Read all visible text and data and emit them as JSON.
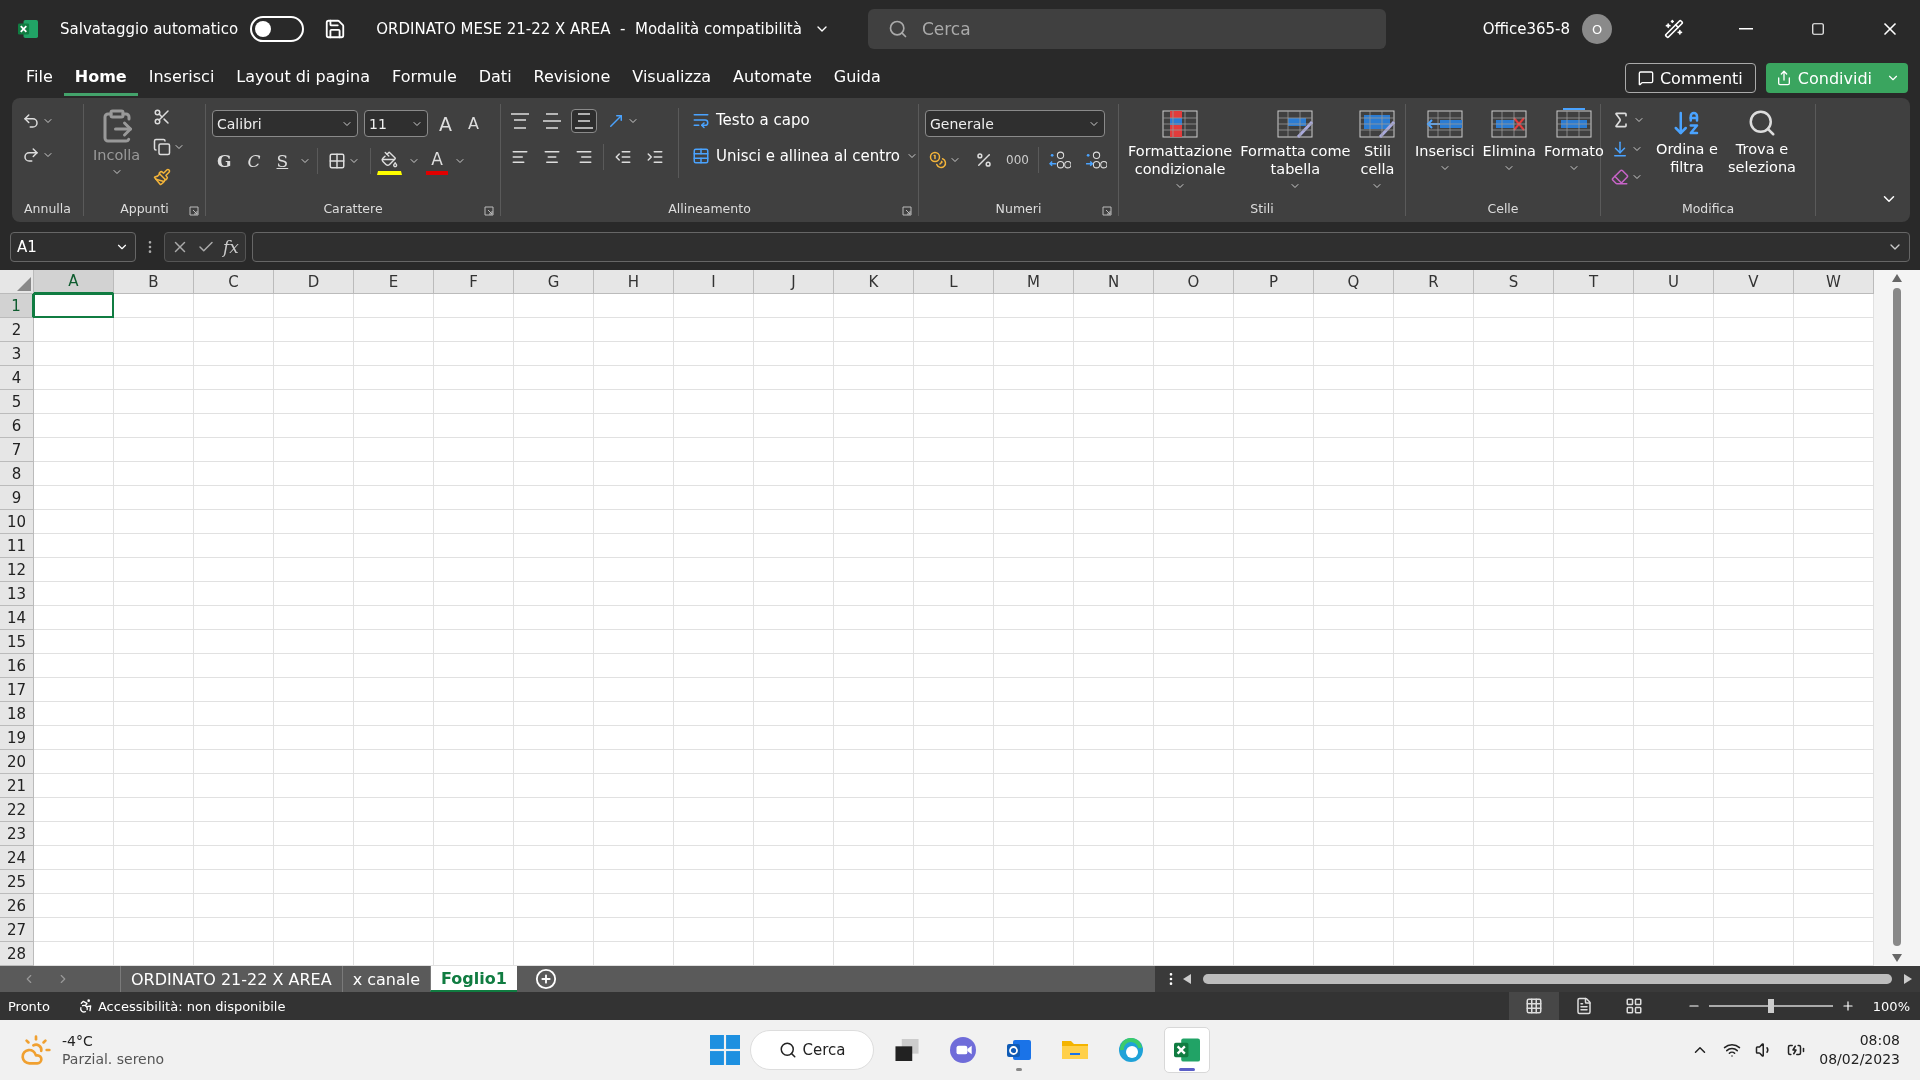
{
  "title_bar": {
    "autosave_label": "Salvataggio automatico",
    "autosave_on": false,
    "document_title": "ORDINATO MESE 21-22 X AREA  -  Modalità compatibilità",
    "search_placeholder": "Cerca",
    "account": "Office365-8",
    "avatar_initial": "O"
  },
  "menu_tabs": [
    {
      "label": "File",
      "selected": false
    },
    {
      "label": "Home",
      "selected": true
    },
    {
      "label": "Inserisci",
      "selected": false
    },
    {
      "label": "Layout di pagina",
      "selected": false
    },
    {
      "label": "Formule",
      "selected": false
    },
    {
      "label": "Dati",
      "selected": false
    },
    {
      "label": "Revisione",
      "selected": false
    },
    {
      "label": "Visualizza",
      "selected": false
    },
    {
      "label": "Automate",
      "selected": false
    },
    {
      "label": "Guida",
      "selected": false
    }
  ],
  "actions": {
    "comments": "Commenti",
    "share": "Condividi"
  },
  "ribbon": {
    "undo": {
      "label": "Annulla"
    },
    "clipboard": {
      "label": "Appunti",
      "paste": "Incolla"
    },
    "font": {
      "label": "Carattere",
      "font_name": "Calibri",
      "font_size": "11",
      "grow": "A",
      "shrink": "A",
      "bold": "G",
      "italic": "C",
      "underline": "S",
      "font_color": "A"
    },
    "alignment": {
      "label": "Allineamento",
      "vertical": [
        {
          "selected": false
        },
        {
          "selected": false
        },
        {
          "selected": true
        }
      ],
      "wrap": "Testo a capo",
      "merge": "Unisci e allinea al centro"
    },
    "number": {
      "label": "Numeri",
      "format": "Generale",
      "thousands": "000"
    },
    "styles": {
      "label": "Stili",
      "buttons": [
        {
          "kind": "conditional",
          "label": "Formattazione\ncondizionale"
        },
        {
          "kind": "table",
          "label": "Formatta come\ntabella"
        },
        {
          "kind": "cell",
          "label": "Stili\ncella"
        }
      ]
    },
    "cells": {
      "label": "Celle",
      "buttons": [
        {
          "kind": "insert",
          "label": "Inserisci"
        },
        {
          "kind": "delete",
          "label": "Elimina"
        },
        {
          "kind": "format",
          "label": "Formato"
        }
      ]
    },
    "editing": {
      "label": "Modifica",
      "buttons": [
        {
          "kind": "sort",
          "label": "Ordina e\nfiltra"
        },
        {
          "kind": "find",
          "label": "Trova e\nseleziona"
        }
      ]
    }
  },
  "formula_bar": {
    "name_box": "A1",
    "function_glyph": "fx"
  },
  "grid": {
    "columns": [
      {
        "label": "A",
        "selected": true
      },
      {
        "label": "B",
        "selected": false
      },
      {
        "label": "C",
        "selected": false
      },
      {
        "label": "D",
        "selected": false
      },
      {
        "label": "E",
        "selected": false
      },
      {
        "label": "F",
        "selected": false
      },
      {
        "label": "G",
        "selected": false
      },
      {
        "label": "H",
        "selected": false
      },
      {
        "label": "I",
        "selected": false
      },
      {
        "label": "J",
        "selected": false
      },
      {
        "label": "K",
        "selected": false
      },
      {
        "label": "L",
        "selected": false
      },
      {
        "label": "M",
        "selected": false
      },
      {
        "label": "N",
        "selected": false
      },
      {
        "label": "O",
        "selected": false
      },
      {
        "label": "P",
        "selected": false
      },
      {
        "label": "Q",
        "selected": false
      },
      {
        "label": "R",
        "selected": false
      },
      {
        "label": "S",
        "selected": false
      },
      {
        "label": "T",
        "selected": false
      },
      {
        "label": "U",
        "selected": false
      },
      {
        "label": "V",
        "selected": false
      },
      {
        "label": "W",
        "selected": false
      }
    ],
    "rows": [
      {
        "label": "1",
        "selected": true
      },
      {
        "label": "2",
        "selected": false
      },
      {
        "label": "3",
        "selected": false
      },
      {
        "label": "4",
        "selected": false
      },
      {
        "label": "5",
        "selected": false
      },
      {
        "label": "6",
        "selected": false
      },
      {
        "label": "7",
        "selected": false
      },
      {
        "label": "8",
        "selected": false
      },
      {
        "label": "9",
        "selected": false
      },
      {
        "label": "10",
        "selected": false
      },
      {
        "label": "11",
        "selected": false
      },
      {
        "label": "12",
        "selected": false
      },
      {
        "label": "13",
        "selected": false
      },
      {
        "label": "14",
        "selected": false
      },
      {
        "label": "15",
        "selected": false
      },
      {
        "label": "16",
        "selected": false
      },
      {
        "label": "17",
        "selected": false
      },
      {
        "label": "18",
        "selected": false
      },
      {
        "label": "19",
        "selected": false
      },
      {
        "label": "20",
        "selected": false
      },
      {
        "label": "21",
        "selected": false
      },
      {
        "label": "22",
        "selected": false
      },
      {
        "label": "23",
        "selected": false
      },
      {
        "label": "24",
        "selected": false
      },
      {
        "label": "25",
        "selected": false
      },
      {
        "label": "26",
        "selected": false
      },
      {
        "label": "27",
        "selected": false
      },
      {
        "label": "28",
        "selected": false
      }
    ]
  },
  "sheet_tabs": [
    {
      "label": "ORDINATO 21-22 X AREA",
      "selected": false
    },
    {
      "label": "x canale",
      "selected": false
    },
    {
      "label": "Foglio1",
      "selected": true
    }
  ],
  "status_bar": {
    "status": "Pronto",
    "accessibility": "Accessibilità: non disponibile",
    "views": [
      {
        "kind": "normal",
        "selected": true
      },
      {
        "kind": "page",
        "selected": false
      },
      {
        "kind": "break",
        "selected": false
      }
    ],
    "zoom": {
      "level": 0.5
    },
    "zoom_label": "100%"
  },
  "taskbar": {
    "temperature": "-4°C",
    "weather": "Parzial. sereno",
    "search": "Cerca",
    "apps": [
      {
        "kind": "taskview",
        "running": false,
        "selected": false
      },
      {
        "kind": "meet",
        "running": false,
        "selected": false
      },
      {
        "kind": "outlook",
        "running": true,
        "selected": false
      },
      {
        "kind": "files",
        "running": false,
        "selected": false
      },
      {
        "kind": "edge",
        "running": false,
        "selected": false
      },
      {
        "kind": "excel",
        "running": true,
        "selected": true
      }
    ],
    "time": "08:08",
    "date": "08/02/2023"
  }
}
